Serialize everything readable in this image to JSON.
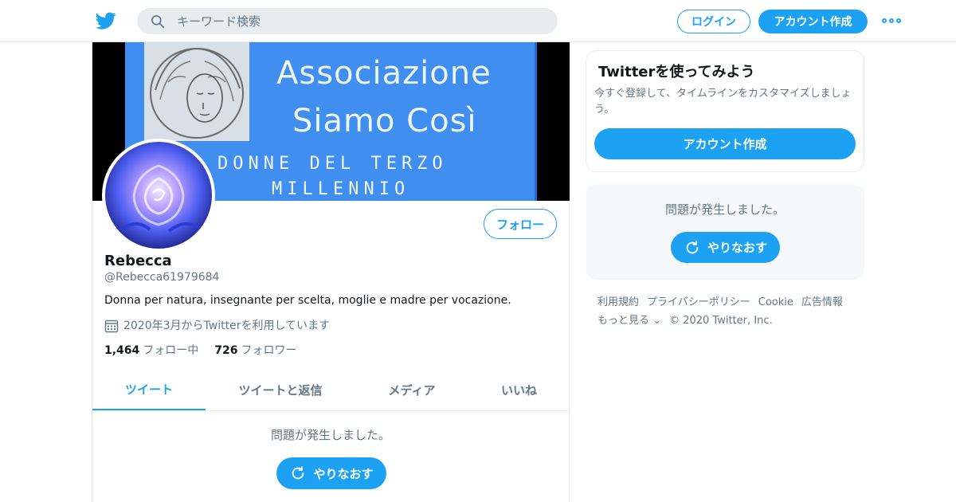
{
  "header": {
    "search_placeholder": "キーワード検索",
    "login_label": "ログイン",
    "signup_label": "アカウント作成",
    "logo_icon": "twitter-bird-icon",
    "more_icon": "more-dots-icon"
  },
  "banner": {
    "line1": "Associazione",
    "line2": "Siamo Così",
    "line3": "DONNE DEL TERZO",
    "line4": "MILLENNIO"
  },
  "profile": {
    "follow_label": "フォロー",
    "name": "Rebecca",
    "handle": "@Rebecca61979684",
    "bio": "Donna per natura, insegnante per scelta, moglie e madre per vocazione.",
    "joined": "2020年3月からTwitterを利用しています",
    "following_count": "1,464",
    "following_label": "フォロー中",
    "followers_count": "726",
    "followers_label": "フォロワー"
  },
  "tabs": [
    {
      "label": "ツイート",
      "active": true
    },
    {
      "label": "ツイートと返信",
      "active": false
    },
    {
      "label": "メディア",
      "active": false
    },
    {
      "label": "いいね",
      "active": false
    }
  ],
  "timeline": {
    "error_text": "問題が発生しました。",
    "retry_label": "やりなおす"
  },
  "signup_card": {
    "title": "Twitterを使ってみよう",
    "description": "今すぐ登録して、タイムラインをカスタマイズしましょう。",
    "button_label": "アカウント作成"
  },
  "sidebar_error": {
    "error_text": "問題が発生しました。",
    "retry_label": "やりなおす"
  },
  "footer": {
    "links": [
      "利用規約",
      "プライバシーポリシー",
      "Cookie",
      "広告情報"
    ],
    "more_label": "もっと見る",
    "copyright": "© 2020 Twitter, Inc."
  },
  "colors": {
    "accent": "#1da1f2",
    "text": "#14171a",
    "muted": "#657786",
    "border": "#e6ecf0"
  }
}
